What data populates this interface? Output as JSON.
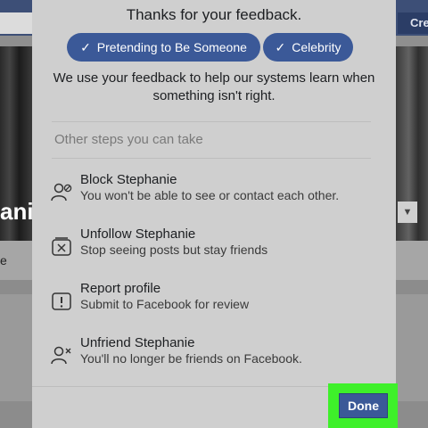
{
  "background": {
    "create_label": "Cre",
    "name_fragment": "ani",
    "tab_fragment": "e",
    "dropdown_glyph": "▼"
  },
  "dialog": {
    "title": "Thanks for your feedback.",
    "selected_reasons": [
      {
        "label": "Pretending to Be Someone",
        "icon": "check-icon"
      },
      {
        "label": "Celebrity",
        "icon": "check-icon"
      }
    ],
    "explanation_line1": "We use your feedback to help our systems learn when",
    "explanation_line2": "something isn't right.",
    "steps_header": "Other steps you can take",
    "steps": [
      {
        "title": "Block Stephanie",
        "description": "You won't be able to see or contact each other.",
        "icon": "block-user-icon"
      },
      {
        "title": "Unfollow Stephanie",
        "description": "Stop seeing posts but stay friends",
        "icon": "unfollow-icon"
      },
      {
        "title": "Report profile",
        "description": "Submit to Facebook for review",
        "icon": "report-icon"
      },
      {
        "title": "Unfriend Stephanie",
        "description": "You'll no longer be friends on Facebook.",
        "icon": "unfriend-icon"
      }
    ],
    "done_label": "Done"
  },
  "colors": {
    "brand_blue": "#3b5998",
    "highlight_green": "#3ef02a",
    "dialog_bg": "#cfcfcf"
  }
}
